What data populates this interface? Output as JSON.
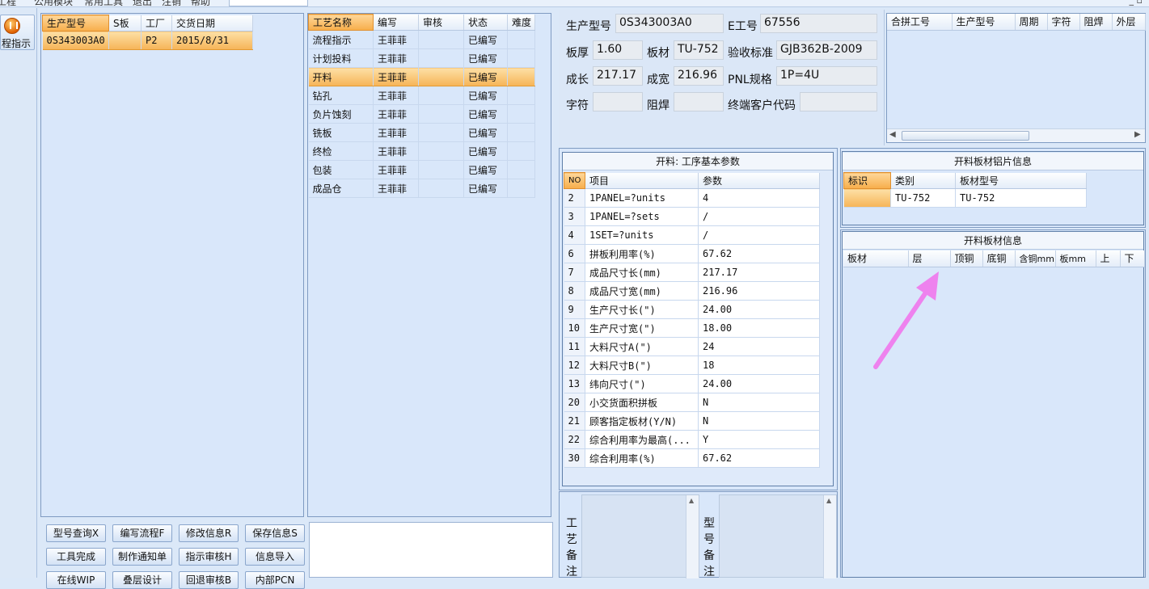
{
  "menu": {
    "items": [
      "工程",
      "公用模块",
      "常用工具",
      "退出",
      "注销",
      "帮助"
    ]
  },
  "window_controls": "_ ▫",
  "left_nav": {
    "program_button": "程指示"
  },
  "orders_table": {
    "headers": [
      "生产型号",
      "S板",
      "工厂",
      "交货日期"
    ],
    "rows": [
      [
        "0S343003A0",
        "",
        "P2",
        "2015/8/31"
      ]
    ]
  },
  "process_table": {
    "headers": [
      "工艺名称",
      "编写",
      "审核",
      "状态",
      "难度"
    ],
    "rows": [
      [
        "流程指示",
        "王菲菲",
        "",
        "已编写",
        ""
      ],
      [
        "计划投料",
        "王菲菲",
        "",
        "已编写",
        ""
      ],
      [
        "开料",
        "王菲菲",
        "",
        "已编写",
        ""
      ],
      [
        "钻孔",
        "王菲菲",
        "",
        "已编写",
        ""
      ],
      [
        "负片蚀刻",
        "王菲菲",
        "",
        "已编写",
        ""
      ],
      [
        "铣板",
        "王菲菲",
        "",
        "已编写",
        ""
      ],
      [
        "终检",
        "王菲菲",
        "",
        "已编写",
        ""
      ],
      [
        "包装",
        "王菲菲",
        "",
        "已编写",
        ""
      ],
      [
        "成品仓",
        "王菲菲",
        "",
        "已编写",
        ""
      ]
    ],
    "selected_index": 2
  },
  "buttons": {
    "row1": [
      "型号查询X",
      "编写流程F",
      "修改信息R",
      "保存信息S"
    ],
    "row2": [
      "工具完成",
      "制作通知单",
      "指示审核H",
      "信息导入"
    ],
    "row3": [
      "在线WIP",
      "叠层设计",
      "回退审核B",
      "内部PCN"
    ]
  },
  "info": {
    "model_label": "生产型号",
    "model_value": "0S343003A0",
    "eno_label": "E工号",
    "eno_value": "67556",
    "thickness_label": "板厚",
    "thickness_value": "1.60",
    "material_label": "板材",
    "material_value": "TU-752",
    "standard_label": "验收标准",
    "standard_value": "GJB362B-2009",
    "length_label": "成长",
    "length_value": "217.17",
    "width_label": "成宽",
    "width_value": "216.96",
    "pnl_label": "PNL规格",
    "pnl_value": "1P=4U",
    "char_label": "字符",
    "char_value": "",
    "mask_label": "阻焊",
    "mask_value": "",
    "customer_label": "终端客户代码",
    "customer_value": ""
  },
  "combo_table": {
    "headers": [
      "合拼工号",
      "生产型号",
      "周期",
      "字符",
      "阻焊",
      "外层"
    ]
  },
  "params": {
    "title": "开料: 工序基本参数",
    "headers": [
      "NO",
      "项目",
      "参数"
    ],
    "rows": [
      [
        "2",
        "1PANEL=?units",
        "4"
      ],
      [
        "3",
        "1PANEL=?sets",
        "/"
      ],
      [
        "4",
        "1SET=?units",
        "/"
      ],
      [
        "6",
        "拼板利用率(%)",
        "67.62"
      ],
      [
        "7",
        "成品尺寸长(mm)",
        "217.17"
      ],
      [
        "8",
        "成品尺寸宽(mm)",
        "216.96"
      ],
      [
        "9",
        "生产尺寸长(\")",
        "24.00"
      ],
      [
        "10",
        "生产尺寸宽(\")",
        "18.00"
      ],
      [
        "11",
        "大料尺寸A(\")",
        "24"
      ],
      [
        "12",
        "大料尺寸B(\")",
        "18"
      ],
      [
        "13",
        "纬向尺寸(\")",
        "24.00"
      ],
      [
        "20",
        "小交货面积拼板",
        "N"
      ],
      [
        "21",
        "顾客指定板材(Y/N)",
        "N"
      ],
      [
        "22",
        "综合利用率为最高(...",
        "Y"
      ],
      [
        "30",
        "综合利用率(%)",
        "67.62"
      ]
    ]
  },
  "sheet_info": {
    "title": "开料板材铝片信息",
    "headers": [
      "标识",
      "类别",
      "板材型号"
    ],
    "rows": [
      [
        "",
        "TU-752",
        "TU-752"
      ]
    ]
  },
  "material_info": {
    "title": "开料板材信息",
    "headers": [
      "板材",
      "层",
      "顶铜",
      "底铜",
      "含铜mm",
      "板mm",
      "上",
      "下"
    ]
  },
  "remarks": {
    "process_label": "工艺备注",
    "model_label": "型号备注"
  },
  "colors": {
    "selection": "#f6b457",
    "arrow": "#ee82ee",
    "panel": "#d9e7fa"
  }
}
